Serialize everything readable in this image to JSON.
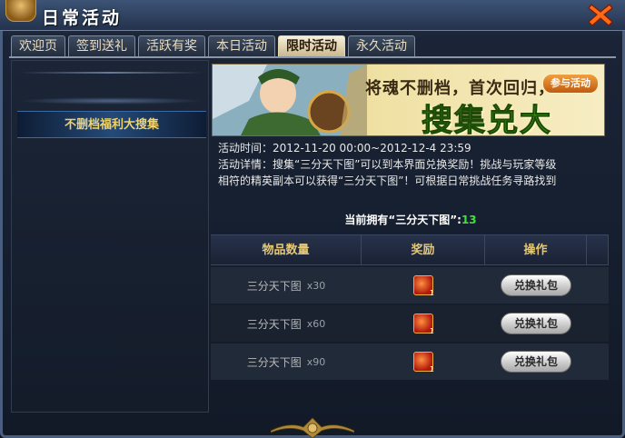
{
  "window": {
    "title": "日常活动",
    "close_icon": "close-icon",
    "accent": "#f2d36a"
  },
  "tabs": [
    {
      "label": "欢迎页"
    },
    {
      "label": "签到送礼"
    },
    {
      "label": "活跃有奖"
    },
    {
      "label": "本日活动"
    },
    {
      "label": "限时活动",
      "active": true
    },
    {
      "label": "永久活动"
    }
  ],
  "sidebar": {
    "items": [
      {
        "label": "不删档福利大搜集",
        "selected": true
      }
    ]
  },
  "banner": {
    "slogan": "将魂不删档，首次回归，",
    "join_label": "参与活动",
    "headline": "搜集兑大奖！"
  },
  "event": {
    "time_line": "活动时间：2012-11-20 00:00~2012-12-4 23:59",
    "detail_line1": "活动详情：搜集“三分天下图”可以到本界面兑换奖励！挑战与玩家等级",
    "detail_line2": "相符的精英副本可以获得“三分天下图”！可根据日常挑战任务寻路找到",
    "owned_label": "当前拥有“三分天下图”:",
    "owned_count": "13"
  },
  "table": {
    "headers": [
      "物品数量",
      "奖励",
      "操作"
    ],
    "rows": [
      {
        "item": "三分天下图",
        "qty": "x30",
        "reward_count": "1",
        "button": "兑换礼包"
      },
      {
        "item": "三分天下图",
        "qty": "x60",
        "reward_count": "1",
        "button": "兑换礼包"
      },
      {
        "item": "三分天下图",
        "qty": "x90",
        "reward_count": "1",
        "button": "兑换礼包"
      }
    ]
  }
}
